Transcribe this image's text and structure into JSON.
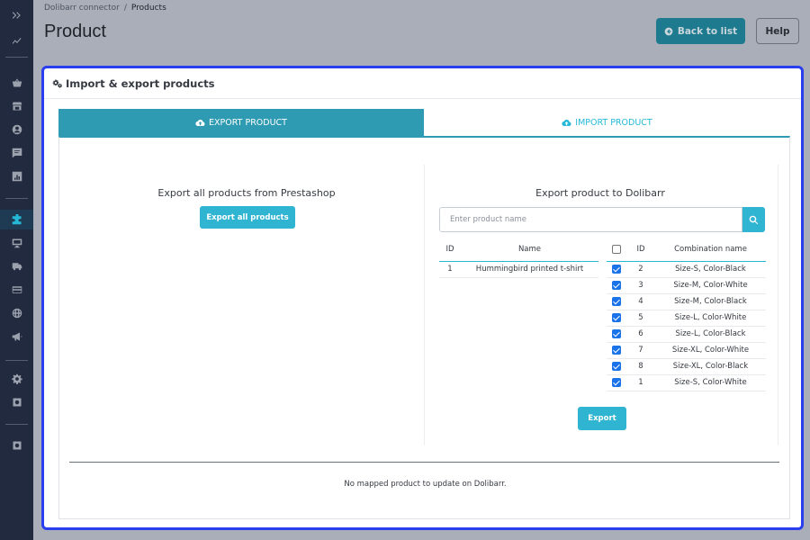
{
  "breadcrumb": {
    "parent": "Dolibarr connector",
    "separator": "/",
    "current": "Products"
  },
  "page": {
    "title": "Product"
  },
  "toolbar": {
    "back_label": "Back to list",
    "help_label": "Help"
  },
  "panel": {
    "title": "Import & export products"
  },
  "tabs": {
    "export": "EXPORT PRODUCT",
    "import": "IMPORT PRODUCT"
  },
  "export_all": {
    "label": "Export all products from Prestashop",
    "button": "Export all products"
  },
  "export_dolibarr": {
    "label": "Export product to Dolibarr",
    "search_placeholder": "Enter product name",
    "product_table": {
      "headers": [
        "ID",
        "Name"
      ],
      "rows": [
        {
          "id": "1",
          "name": "Hummingbird printed t-shirt"
        }
      ]
    },
    "combination_table": {
      "headers": [
        "ID",
        "Combination name"
      ],
      "rows": [
        {
          "id": "2",
          "name": "Size-S, Color-Black",
          "checked": true
        },
        {
          "id": "3",
          "name": "Size-M, Color-White",
          "checked": true
        },
        {
          "id": "4",
          "name": "Size-M, Color-Black",
          "checked": true
        },
        {
          "id": "5",
          "name": "Size-L, Color-White",
          "checked": true
        },
        {
          "id": "6",
          "name": "Size-L, Color-Black",
          "checked": true
        },
        {
          "id": "7",
          "name": "Size-XL, Color-White",
          "checked": true
        },
        {
          "id": "8",
          "name": "Size-XL, Color-Black",
          "checked": true
        },
        {
          "id": "1",
          "name": "Size-S, Color-White",
          "checked": true
        }
      ]
    },
    "export_button": "Export"
  },
  "footer_message": "No mapped product to update on Dolibarr.",
  "colors": {
    "accent": "#25b9d7",
    "tab_active": "#2e9bb3",
    "focus_border": "#2a3ef0",
    "sidebar": "#212a3f"
  },
  "sidebar_icons": [
    "expand-icon",
    "stats-icon",
    "basket-icon",
    "store-icon",
    "customer-icon",
    "messages-icon",
    "chart-icon",
    "modules-icon",
    "monitor-icon",
    "truck-icon",
    "card-icon",
    "globe-icon",
    "megaphone-icon",
    "settings-icon",
    "advanced-icon",
    "extension-icon"
  ]
}
